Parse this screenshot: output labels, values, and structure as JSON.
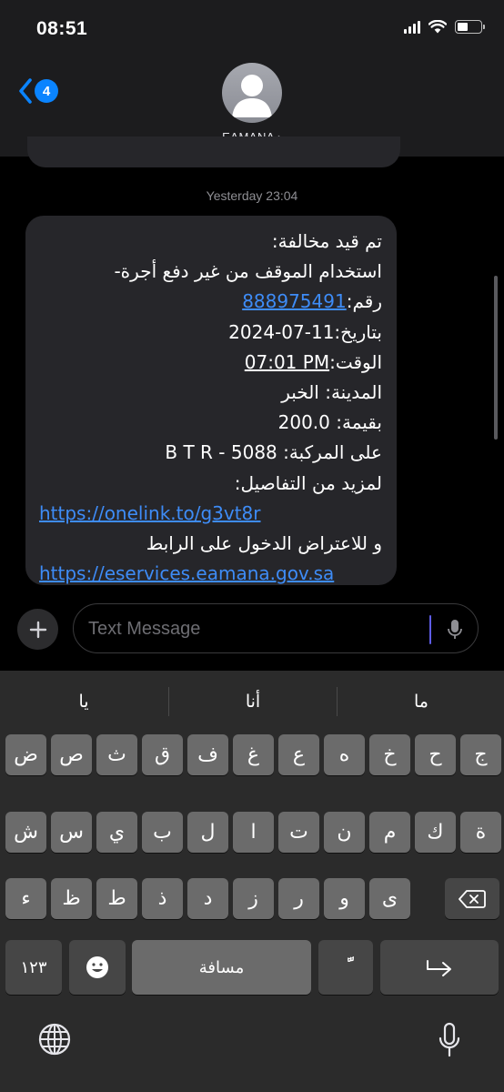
{
  "status_bar": {
    "time": "08:51"
  },
  "header": {
    "back_badge": "4",
    "contact_name": "EAMANA"
  },
  "thread": {
    "timestamp": "Yesterday 23:04",
    "message": {
      "l1": "تم قيد مخالفة:",
      "l2": "استخدام الموقف من غير دفع أجرة-",
      "l3_prefix": "رقم:",
      "l3_number": "888975491",
      "l4": "بتاريخ:11-07-2024",
      "l5_prefix": "الوقت:",
      "l5_time": "07:01 PM",
      "l6": "المدينة: الخبر",
      "l7": "بقيمة: 200.0",
      "l8": "على المركبة: 5088 - B T R",
      "l9": "لمزيد من التفاصيل:",
      "link1": "https://onelink.to/g3vt8r",
      "l11": "و للاعتراض الدخول على الرابط",
      "link2": "https://eservices.eamana.gov.sa"
    }
  },
  "compose": {
    "placeholder": "Text Message"
  },
  "keyboard": {
    "suggestions": [
      "يا",
      "أنا",
      "ما"
    ],
    "row1": [
      "ض",
      "ص",
      "ث",
      "ق",
      "ف",
      "غ",
      "ع",
      "ه",
      "خ",
      "ح",
      "ج"
    ],
    "row2": [
      "ش",
      "س",
      "ي",
      "ب",
      "ل",
      "ا",
      "ت",
      "ن",
      "م",
      "ك",
      "ة"
    ],
    "row3": [
      "ء",
      "ظ",
      "ط",
      "ذ",
      "د",
      "ز",
      "ر",
      "و",
      "ى"
    ],
    "numbers_key": "١٢٣",
    "space_key": "مسافة",
    "diacritic_key": "ًّ"
  }
}
